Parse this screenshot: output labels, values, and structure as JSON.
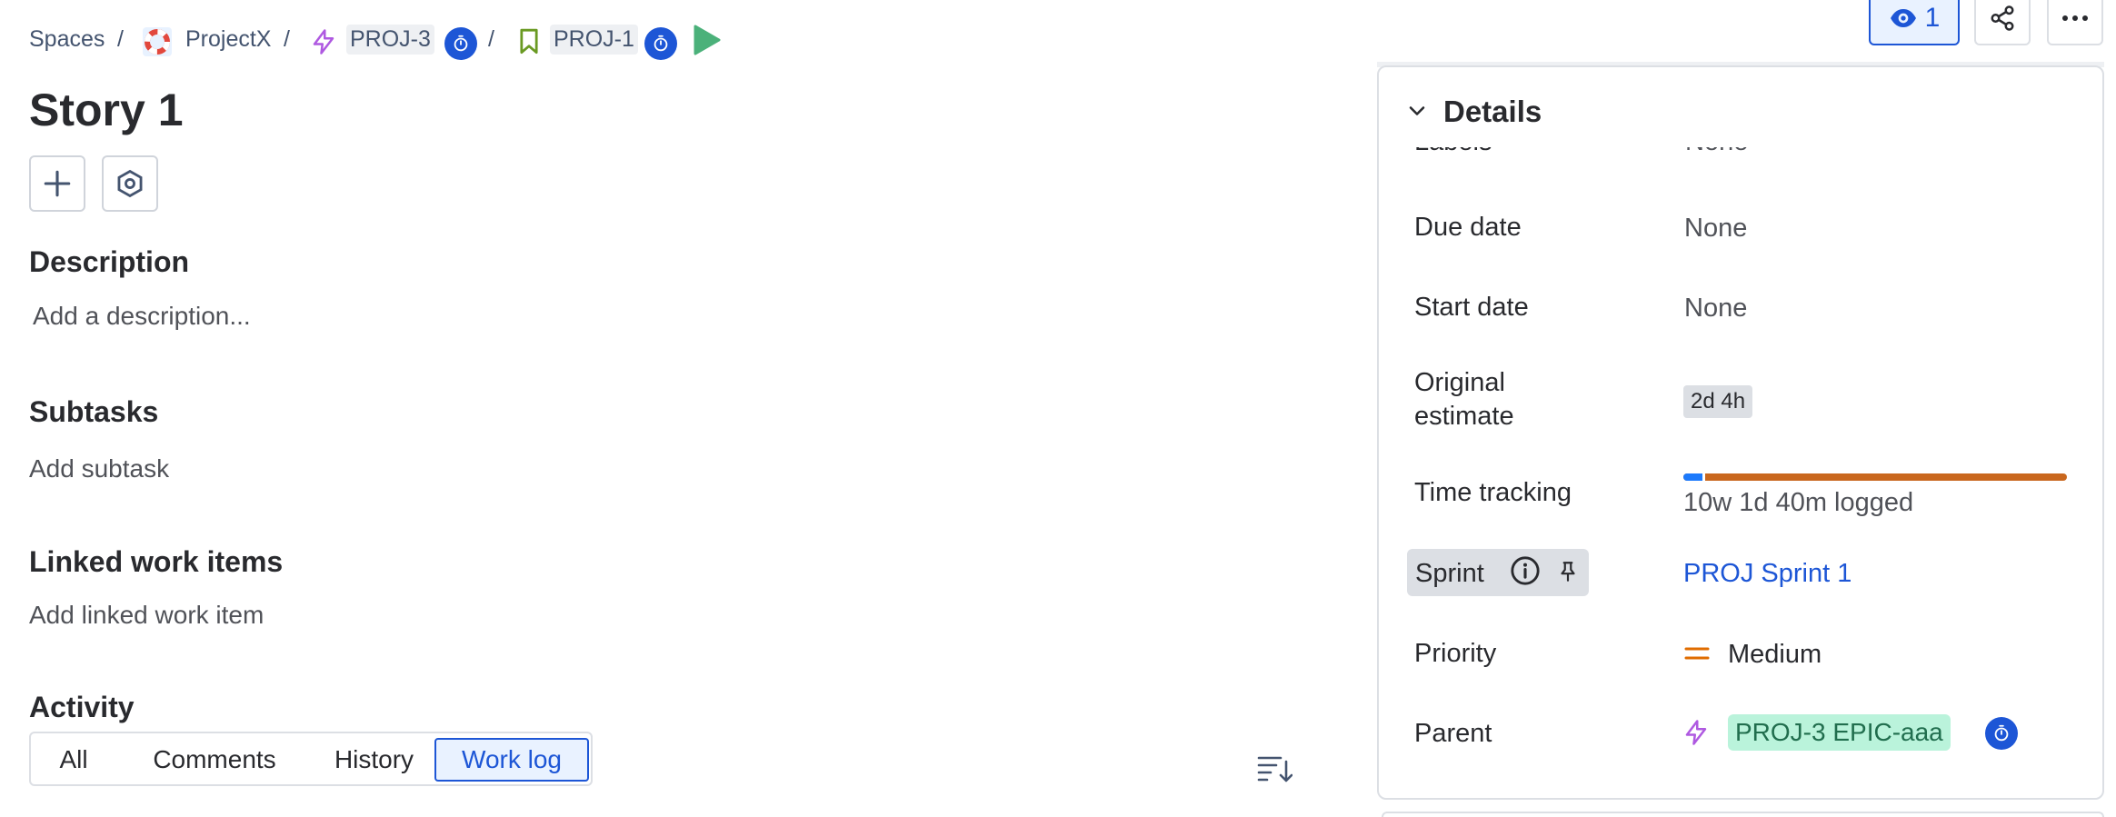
{
  "breadcrumb": {
    "spaces": "Spaces",
    "sep": "/",
    "project": "ProjectX",
    "epic_key": "PROJ-3",
    "story_key": "PROJ-1"
  },
  "issue": {
    "title": "Story 1"
  },
  "sections": {
    "description_title": "Description",
    "description_placeholder": "Add a description...",
    "subtasks_title": "Subtasks",
    "subtasks_add": "Add subtask",
    "linked_title": "Linked work items",
    "linked_add": "Add linked work item",
    "activity_title": "Activity"
  },
  "activity_tabs": [
    {
      "label": "All",
      "active": false
    },
    {
      "label": "Comments",
      "active": false
    },
    {
      "label": "History",
      "active": false
    },
    {
      "label": "Work log",
      "active": true
    }
  ],
  "header_actions": {
    "watch_count": "1"
  },
  "details": {
    "title": "Details",
    "partial_label": "Labels",
    "partial_value": "None",
    "fields": {
      "due_date": {
        "label": "Due date",
        "value": "None"
      },
      "start_date": {
        "label": "Start date",
        "value": "None"
      },
      "original_estimate": {
        "label_line1": "Original",
        "label_line2": "estimate",
        "value": "2d 4h"
      },
      "time_tracking": {
        "label": "Time tracking",
        "value": "10w 1d 40m logged",
        "logged_fraction": 0.05
      },
      "sprint": {
        "label": "Sprint",
        "value": "PROJ Sprint 1"
      },
      "priority": {
        "label": "Priority",
        "value": "Medium"
      },
      "parent": {
        "label": "Parent",
        "value": "PROJ-3 EPIC-aaa"
      }
    }
  },
  "colors": {
    "accent": "#1D56D6",
    "epic": "#AF59E1",
    "story": "#6A9A23",
    "priority_medium": "#E06C00",
    "tracking_logged": "#1D7AFC",
    "tracking_remaining": "#C9671E",
    "run": "#4BB17A"
  },
  "icons": {
    "project_avatar": "lifebuoy-avatar-icon",
    "epic": "lightning-icon",
    "story": "bookmark-icon",
    "timer": "stopwatch-icon",
    "run": "play-icon",
    "add": "plus-icon",
    "apps": "hexagon-icon",
    "watch": "eye-icon",
    "share": "share-icon",
    "more": "more-icon",
    "sort": "sort-icon",
    "chevron": "chevron-down-icon",
    "info": "info-icon",
    "pin": "pin-icon"
  }
}
